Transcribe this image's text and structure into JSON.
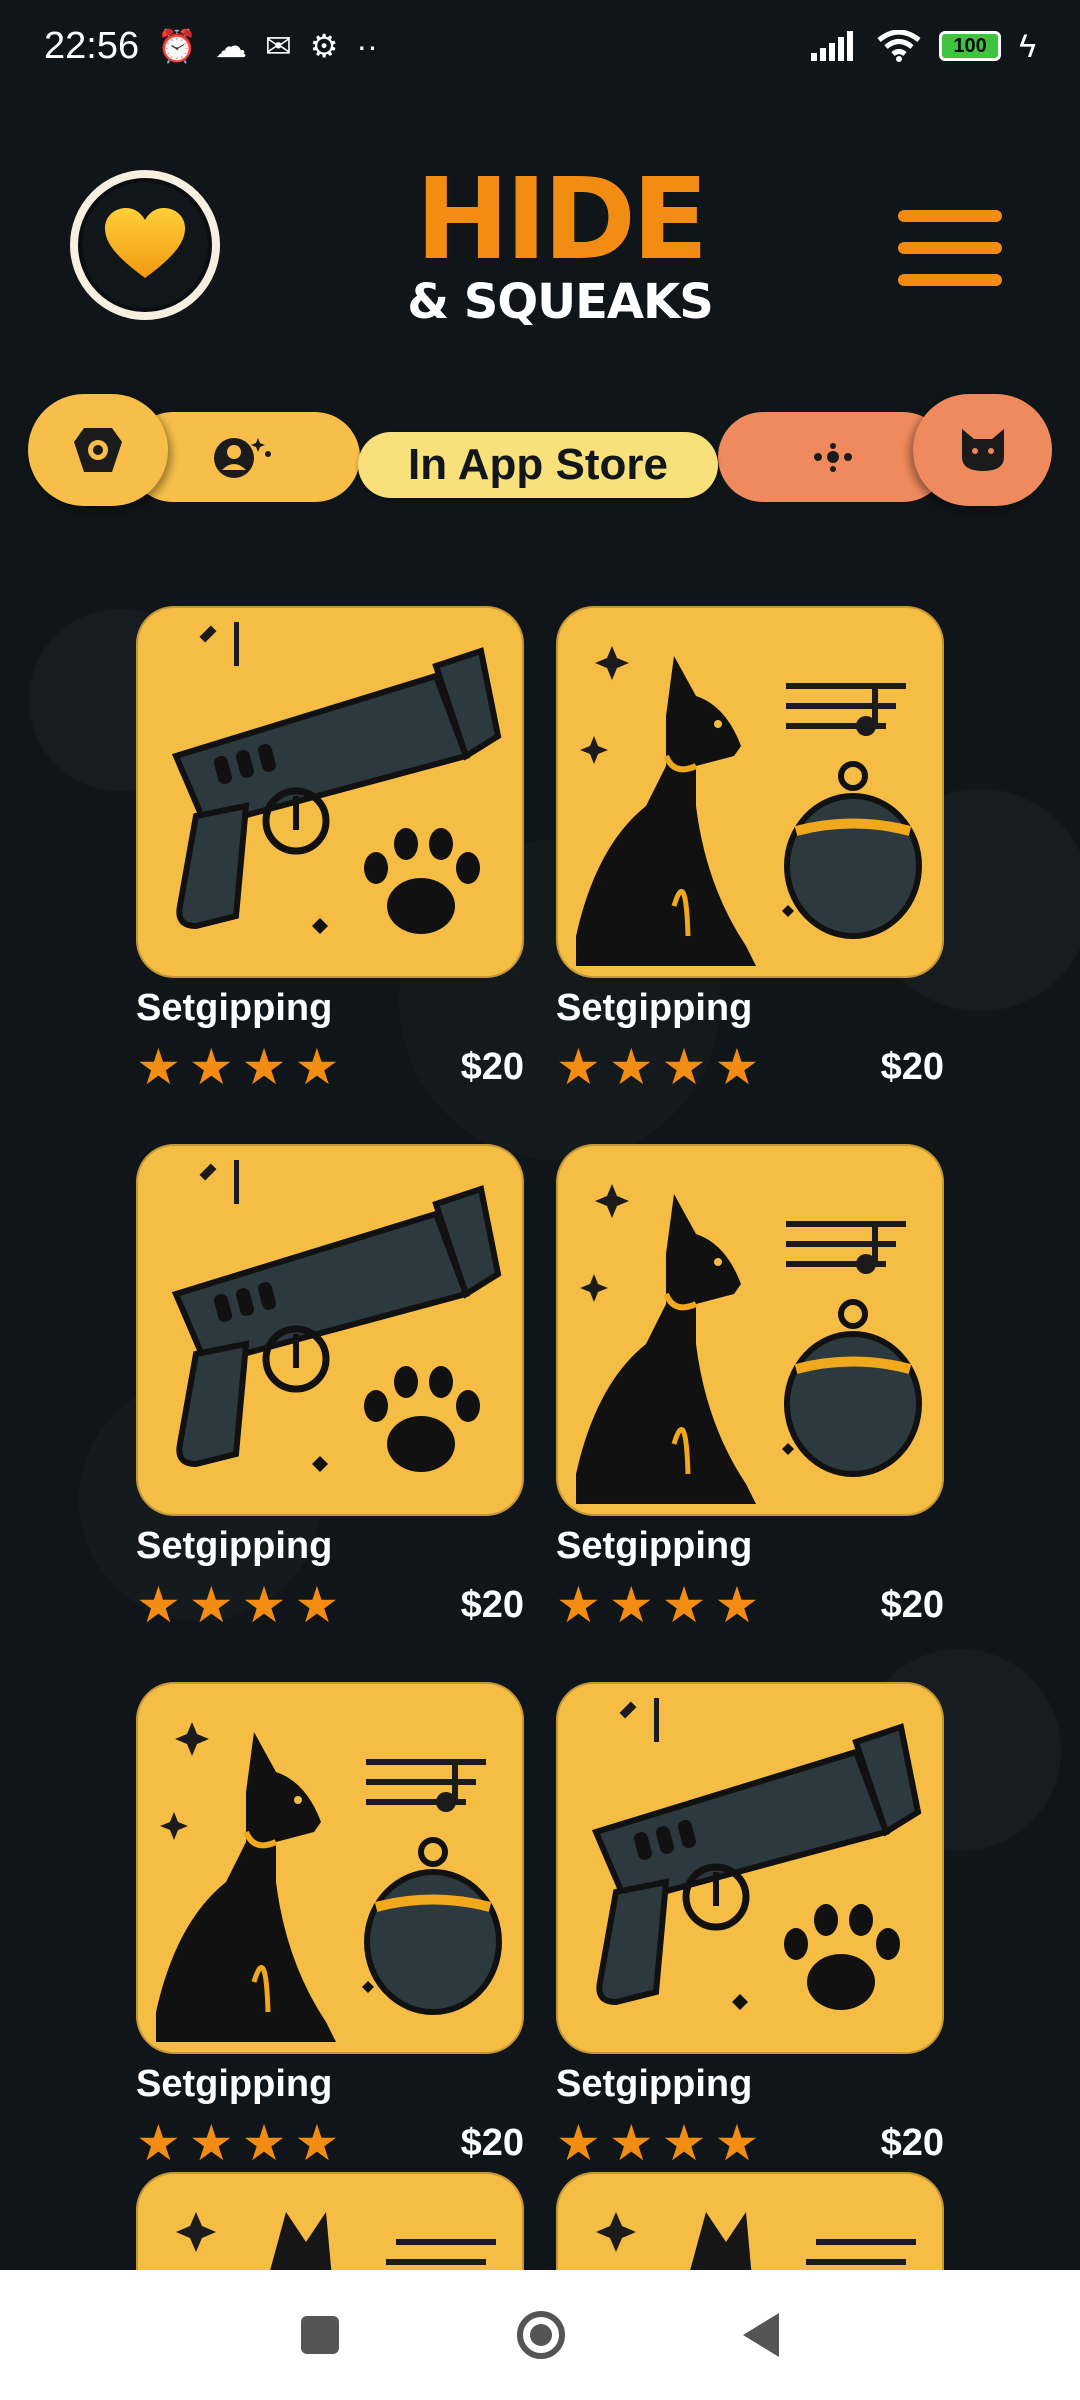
{
  "status_bar": {
    "time": "22:56",
    "battery": "100",
    "left_icons": [
      "alarm-icon",
      "cloud-icon",
      "gmail-icon",
      "settings-icon",
      "more-icon"
    ],
    "right_icons": [
      "signal-icon",
      "wifi-icon",
      "battery-icon",
      "charging-icon"
    ]
  },
  "header": {
    "logo_line1": "HIDE",
    "logo_line2": "& SQUEAKS",
    "favorite_icon": "heart-icon",
    "menu_icon": "hamburger-icon"
  },
  "tabs": {
    "active_label": "In App Store",
    "items": [
      {
        "icon": "collar-icon",
        "color": "#f7bf4a"
      },
      {
        "icon": "avatar-sparkle-icon",
        "color": "#f7bf4a"
      },
      {
        "icon": "dots-icon",
        "color": "#ef8a5e"
      },
      {
        "icon": "cat-icon",
        "color": "#ef8a5e"
      }
    ]
  },
  "products": [
    {
      "title": "Setgipping",
      "price": "$20",
      "rating": 4,
      "image": "squeaker-gun"
    },
    {
      "title": "Setgipping",
      "price": "$20",
      "rating": 4,
      "image": "dog-bell"
    },
    {
      "title": "Setgipping",
      "price": "$20",
      "rating": 4,
      "image": "squeaker-gun"
    },
    {
      "title": "Setgipping",
      "price": "$20",
      "rating": 4,
      "image": "dog-bell"
    },
    {
      "title": "Setgipping",
      "price": "$20",
      "rating": 4,
      "image": "dog-bell"
    },
    {
      "title": "Setgipping",
      "price": "$20",
      "rating": 4,
      "image": "squeaker-gun"
    }
  ],
  "colors": {
    "background": "#0f1518",
    "accent": "#f28c12",
    "card": "#f6bd45",
    "tab_yellow": "#f7bf4a",
    "tab_orange": "#ef8a5e",
    "tab_active": "#f8e07a"
  },
  "nav_bar": [
    "recents-button",
    "home-button",
    "back-button"
  ]
}
